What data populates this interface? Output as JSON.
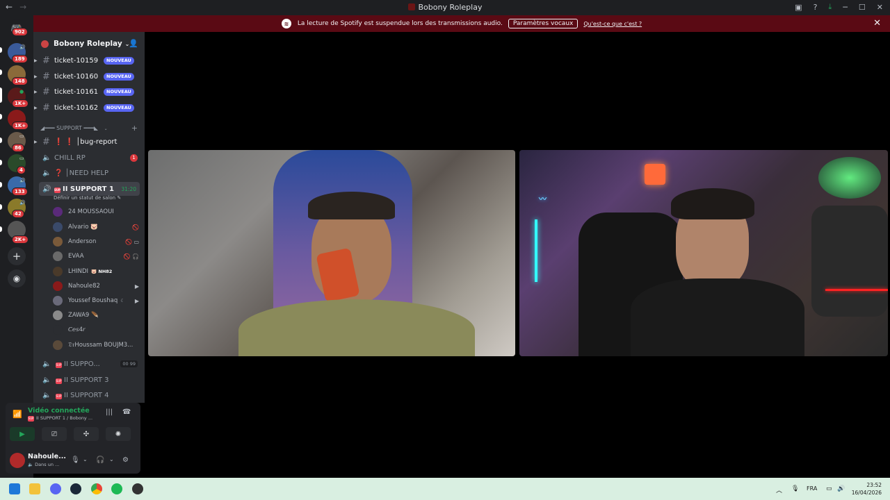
{
  "window": {
    "title": "Bobony Roleplay"
  },
  "banner": {
    "text": "La lecture de Spotify est suspendue lors des transmissions audio.",
    "button": "Paramètres vocaux",
    "link": "Qu'est-ce que c'est ?"
  },
  "servers": [
    {
      "badge": "902"
    },
    {
      "badge": "189"
    },
    {
      "badge": "148"
    },
    {
      "badge": "1K+"
    },
    {
      "badge": "1K+"
    },
    {
      "badge": "86"
    },
    {
      "badge": "4"
    },
    {
      "badge": "133"
    },
    {
      "badge": "42"
    },
    {
      "badge": "2K+"
    }
  ],
  "server_header": {
    "name": "Bobony Roleplay"
  },
  "tickets": [
    {
      "name": "ticket-10159",
      "badge": "NOUVEAU"
    },
    {
      "name": "ticket-10160",
      "badge": "NOUVEAU"
    },
    {
      "name": "ticket-10161",
      "badge": "NOUVEAU"
    },
    {
      "name": "ticket-10162",
      "badge": "NOUVEAU"
    }
  ],
  "category": {
    "name": "◢━━━ SUPPORT ━━━◣"
  },
  "channels": {
    "bug_report": "❗ ❗ │bug-report",
    "chill_rp": "CHILL RP",
    "chill_rp_badge": "1",
    "need_help": "❓ │NEED HELP",
    "support1": "II SUPPORT 1",
    "support1_timer": "31:20",
    "support1_status": "Définir un statut de salon",
    "support_collapsed": "II SUPPO...",
    "support_collapsed_counts": "00 99",
    "support3": "II SUPPORT 3",
    "support4": "II SUPPORT 4"
  },
  "voice_users": [
    {
      "name": "24 MOUSSAOUI",
      "color": "#5a2a7a"
    },
    {
      "name": "Alvario 🐷",
      "color": "#3a4a6a"
    },
    {
      "name": "Anderson",
      "color": "#7a5a3a"
    },
    {
      "name": "EVAA",
      "color": "#6a6a6a"
    },
    {
      "name": "LHINDI",
      "color": "#4a3a2a",
      "tag": "🐷 NH82"
    },
    {
      "name": "Nahoule82",
      "color": "#8a1a1a"
    },
    {
      "name": "Youssef Boushaq",
      "color": "#6a6a7a"
    },
    {
      "name": "ZAWA9 🪶",
      "color": "#8a8a8a"
    },
    {
      "name": "𝘊𝘦𝘴4𝘳",
      "color": "#2b2d31"
    },
    {
      "name": "𝔇𝔯Houssam BOUJM3...",
      "color": "#5a4a3a"
    }
  ],
  "voice_panel": {
    "status": "Vidéo connectée",
    "channel": "II SUPPORT 1 / Bobony ...",
    "user": "Nahoule...",
    "user_status": "Dans un ..."
  },
  "taskbar": {
    "lang": "FRA",
    "time": "23:52",
    "date": "16/04/2026"
  }
}
